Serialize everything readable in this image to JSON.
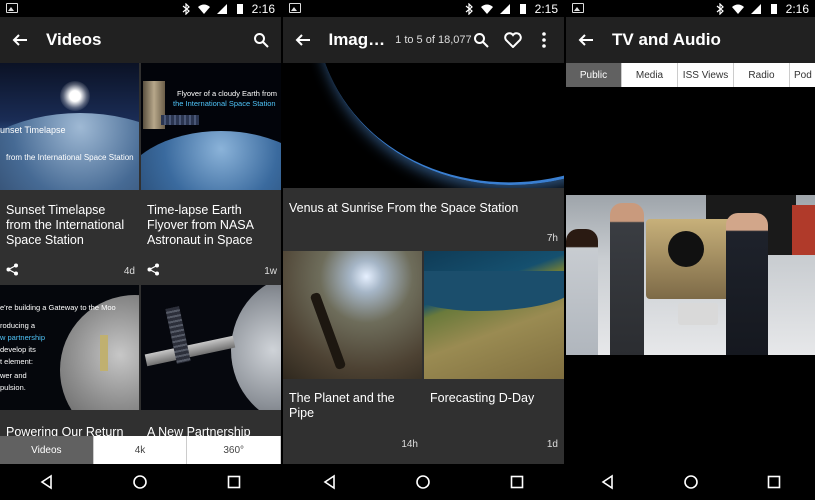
{
  "panel1": {
    "status": {
      "time": "2:16"
    },
    "appbar": {
      "title": "Videos"
    },
    "cards": [
      {
        "title": "Sunset Timelapse from the International Space Station",
        "age": "4d",
        "overlay": [
          "unset Timelapse",
          "from the International Space Station"
        ]
      },
      {
        "title": "Time-lapse Earth Flyover from NASA Astronaut in Space",
        "age": "1w",
        "overlay": [
          "Flyover of a cloudy Earth from",
          "the International Space Station"
        ]
      },
      {
        "title": "Powering Our Return",
        "age": "",
        "overlay": [
          "e're building a Gateway to the Moo",
          "roducing a",
          "w partnership",
          "develop its",
          "t element:",
          "wer and",
          "pulsion."
        ]
      },
      {
        "title": "A New Partnership",
        "age": ""
      }
    ],
    "tabs": [
      "Videos",
      "4k",
      "360°"
    ]
  },
  "panel2": {
    "status": {
      "time": "2:15"
    },
    "appbar": {
      "title": "Imag…",
      "count": "1 to 5 of 18,077"
    },
    "cards": [
      {
        "title": "Venus at Sunrise From the Space Station",
        "age": "7h"
      },
      {
        "title": "The Planet and the Pipe",
        "age": "14h"
      },
      {
        "title": "Forecasting D-Day",
        "age": "1d"
      }
    ]
  },
  "panel3": {
    "status": {
      "time": "2:16"
    },
    "appbar": {
      "title": "TV and Audio"
    },
    "tabs": [
      "Public",
      "Media",
      "ISS Views",
      "Radio",
      "Pod"
    ]
  },
  "colors": {
    "appbar": "#212121",
    "background": "#303030",
    "accent_tab": "#616161"
  }
}
